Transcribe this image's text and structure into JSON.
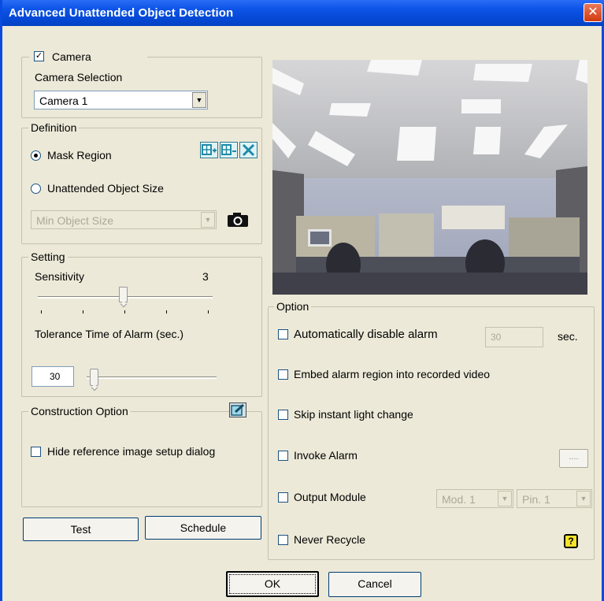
{
  "window": {
    "title": "Advanced Unattended Object Detection",
    "close_glyph": "✕"
  },
  "camera": {
    "legend": "Camera",
    "enabled_glyph": "✓",
    "selection_label": "Camera Selection",
    "selected": "Camera 1"
  },
  "definition": {
    "legend": "Definition",
    "mask_region": "Mask Region",
    "object_size": "Unattended Object Size",
    "size_combo": "Min Object Size",
    "icons": [
      "add-region-icon",
      "remove-region-icon",
      "clear-region-icon",
      "camera-snapshot-icon"
    ]
  },
  "setting": {
    "legend": "Setting",
    "sensitivity_label": "Sensitivity",
    "sensitivity_value": "3",
    "tolerance_label": "Tolerance Time of Alarm (sec.)",
    "tolerance_value": "30"
  },
  "construction": {
    "legend": "Construction Option",
    "hide_dialog": "Hide reference image setup dialog",
    "icon": "edit-icon"
  },
  "buttons": {
    "test": "Test",
    "schedule": "Schedule",
    "ok": "OK",
    "cancel": "Cancel"
  },
  "option": {
    "legend": "Option",
    "auto_disable": "Automatically disable alarm",
    "auto_disable_value": "30",
    "sec": "sec.",
    "embed_region": "Embed alarm region into recorded video",
    "skip_light": "Skip instant light change",
    "invoke_alarm": "Invoke Alarm",
    "invoke_button": "....",
    "output_module": "Output Module",
    "mod_combo": "Mod. 1",
    "pin_combo": "Pin. 1",
    "never_recycle": "Never Recycle",
    "help_icon": "help-icon",
    "help_glyph": "?"
  },
  "colors": {
    "title_bar": "#0a4be0",
    "window_bg": "#ece9d8"
  }
}
